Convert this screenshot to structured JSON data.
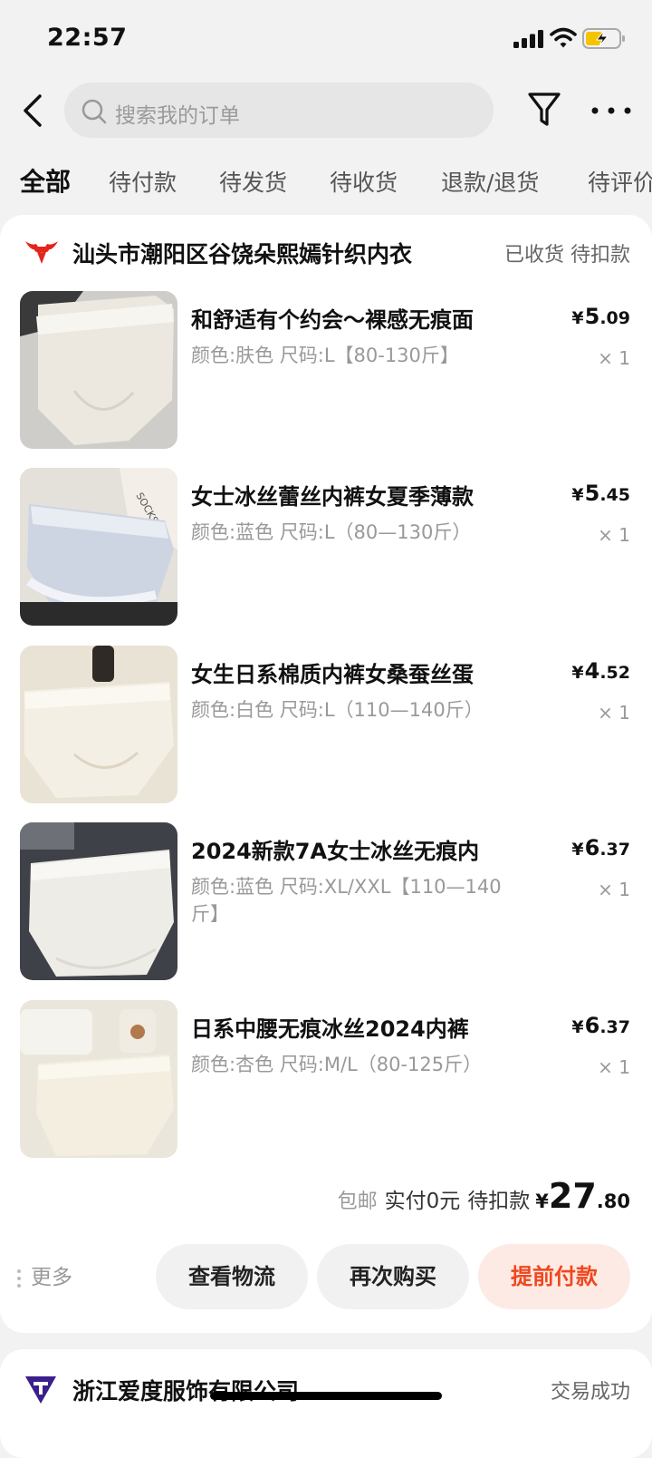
{
  "status_bar": {
    "time": "22:57"
  },
  "search": {
    "placeholder": "搜索我的订单"
  },
  "tabs": [
    "全部",
    "待付款",
    "待发货",
    "待收货",
    "退款/退货",
    "待评价"
  ],
  "order": {
    "shop_name": "汕头市潮阳区谷饶朵熙嫣针织内衣",
    "status": "已收货 待扣款",
    "items": [
      {
        "title": "和舒适有个约会～裸感无痕面",
        "spec": "颜色:肤色 尺码:L【80-130斤】",
        "price_int": "5",
        "price_dec": ".09",
        "qty": "× 1"
      },
      {
        "title": "女士冰丝蕾丝内裤女夏季薄款",
        "spec": "颜色:蓝色 尺码:L（80—130斤）",
        "price_int": "5",
        "price_dec": ".45",
        "qty": "× 1"
      },
      {
        "title": "女生日系棉质内裤女桑蚕丝蛋",
        "spec": "颜色:白色 尺码:L（110—140斤）",
        "price_int": "4",
        "price_dec": ".52",
        "qty": "× 1"
      },
      {
        "title": "2024新款7A女士冰丝无痕内",
        "spec": "颜色:蓝色 尺码:XL/XXL【110—140斤】",
        "price_int": "6",
        "price_dec": ".37",
        "qty": "× 1"
      },
      {
        "title": "日系中腰无痕冰丝2024内裤",
        "spec": "颜色:杏色 尺码:M/L（80-125斤）",
        "price_int": "6",
        "price_dec": ".37",
        "qty": "× 1"
      }
    ],
    "currency": "¥",
    "summary": {
      "shipping": "包邮",
      "paid": "实付0元",
      "pending": "待扣款",
      "total_int": "27",
      "total_dec": ".80"
    },
    "more": "更多",
    "buttons": {
      "logistics": "查看物流",
      "rebuy": "再次购买",
      "pay": "提前付款"
    }
  },
  "order2": {
    "shop_name": "浙江爱度服饰有限公司",
    "status": "交易成功"
  },
  "colors": {
    "accent": "#f0471d",
    "accent_bg": "#fdeae4",
    "muted": "#999999"
  }
}
